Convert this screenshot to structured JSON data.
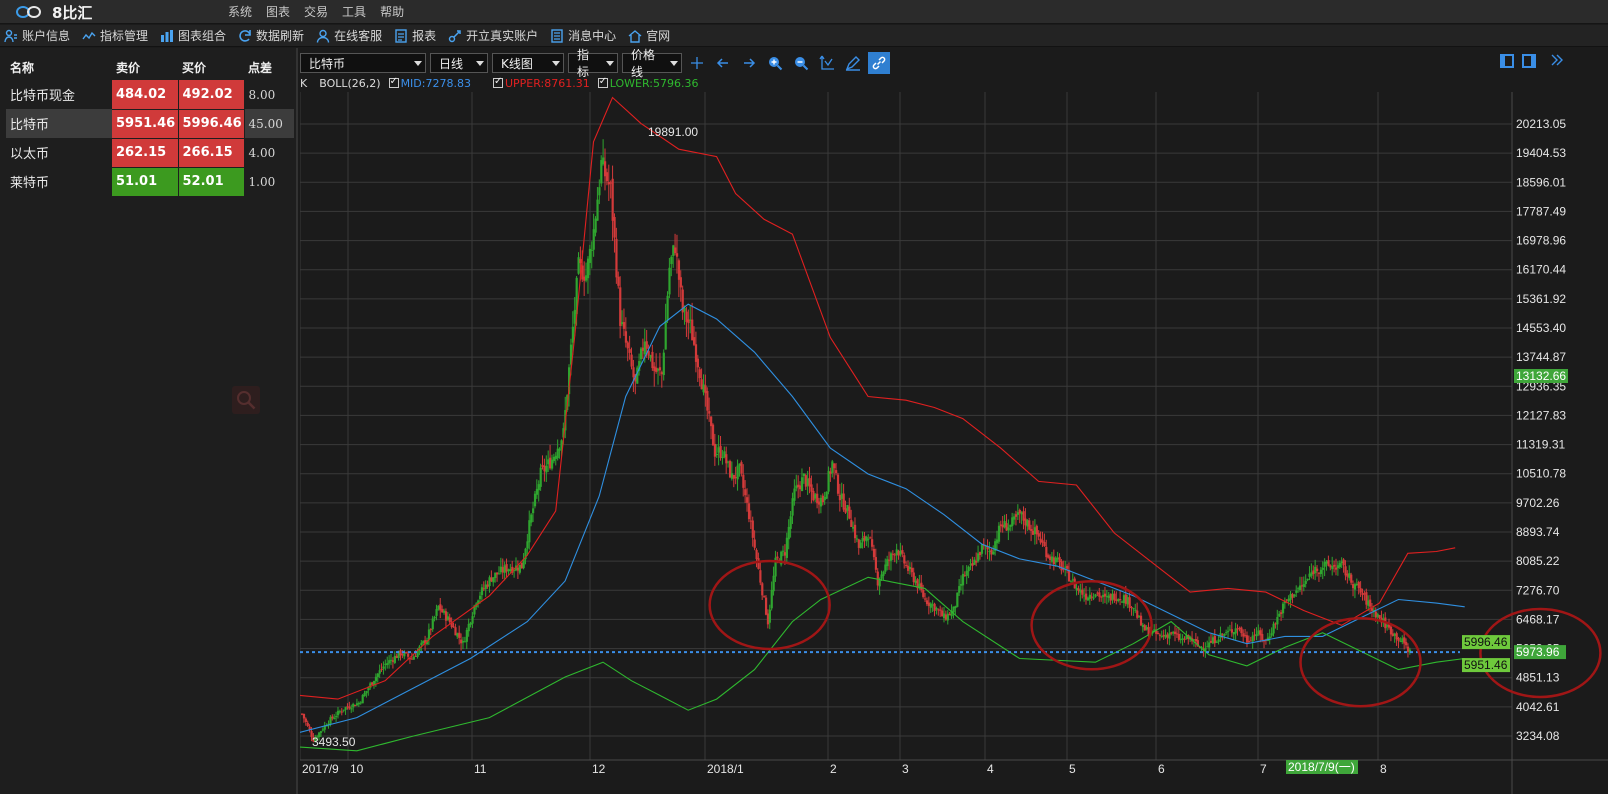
{
  "app": {
    "name": "8比汇",
    "menu": [
      "系统",
      "图表",
      "交易",
      "工具",
      "帮助"
    ]
  },
  "toolbar": [
    {
      "label": "账户信息",
      "icon": "account-icon"
    },
    {
      "label": "指标管理",
      "icon": "indicator-icon"
    },
    {
      "label": "图表组合",
      "icon": "chart-combo-icon"
    },
    {
      "label": "数据刷新",
      "icon": "refresh-icon"
    },
    {
      "label": "在线客服",
      "icon": "support-icon"
    },
    {
      "label": "报表",
      "icon": "report-icon"
    },
    {
      "label": "开立真实账户",
      "icon": "link-icon"
    },
    {
      "label": "消息中心",
      "icon": "message-icon"
    },
    {
      "label": "官网",
      "icon": "home-icon"
    }
  ],
  "quotes": {
    "headers": {
      "name": "名称",
      "bid": "卖价",
      "ask": "买价",
      "spread": "点差"
    },
    "rows": [
      {
        "name": "比特币现金",
        "bid": "484.02",
        "ask": "492.02",
        "spread": "8.00",
        "color": "red",
        "selected": false
      },
      {
        "name": "比特币",
        "bid": "5951.46",
        "ask": "5996.46",
        "spread": "45.00",
        "color": "red",
        "selected": true
      },
      {
        "name": "以太币",
        "bid": "262.15",
        "ask": "266.15",
        "spread": "4.00",
        "color": "red",
        "selected": false
      },
      {
        "name": "莱特币",
        "bid": "51.01",
        "ask": "52.01",
        "spread": "1.00",
        "color": "green",
        "selected": false
      }
    ]
  },
  "chart_toolbar": {
    "symbol": "比特币",
    "period": "日线",
    "chart_type": "K线图",
    "indicator": "指标",
    "price_line": "价格线"
  },
  "legend": {
    "prefix": "K",
    "indicator": "BOLL(26,2)",
    "mid": "MID:7278.83",
    "upper": "UPPER:8761.31",
    "lower": "LOWER:5796.36"
  },
  "colors": {
    "up": "#2fa52f",
    "down": "#d33a3a",
    "mid": "#2f8fe0",
    "upper": "#e02020",
    "lower": "#2fb82f",
    "grid": "#3a3a3a",
    "price_line": "#3b8fea"
  },
  "chart_data": {
    "type": "candlestick",
    "symbol": "比特币",
    "period": "日线",
    "indicator": "BOLL(26,2)",
    "x_axis_labels": [
      "2017/9",
      "10",
      "11",
      "12",
      "2018/1",
      "2",
      "3",
      "4",
      "5",
      "6",
      "7",
      "8"
    ],
    "y_axis_ticks": [
      "20213.05",
      "19404.53",
      "18596.01",
      "17787.49",
      "16978.96",
      "16170.44",
      "15361.92",
      "14553.40",
      "13744.87",
      "12936.35",
      "12127.83",
      "11319.31",
      "10510.78",
      "9702.26",
      "8893.74",
      "8085.22",
      "7276.70",
      "6468.17",
      "5659.65",
      "4851.13",
      "4042.61",
      "3234.08"
    ],
    "ylim": [
      3050,
      21150
    ],
    "high_label": "19891.00",
    "low_label": "3493.50",
    "crosshair_date": "2018/7/9(一)",
    "price_tags": {
      "ask": "5996.46",
      "last": "5973.96",
      "bid": "5951.46",
      "crosshair": "13132.66"
    },
    "price_line_value": 5973.96,
    "close_path": [
      [
        0,
        4300
      ],
      [
        6,
        3600
      ],
      [
        14,
        4100
      ],
      [
        22,
        4450
      ],
      [
        30,
        4600
      ],
      [
        38,
        5250
      ],
      [
        44,
        5650
      ],
      [
        52,
        5950
      ],
      [
        58,
        5800
      ],
      [
        66,
        6350
      ],
      [
        72,
        7200
      ],
      [
        78,
        6800
      ],
      [
        85,
        6200
      ],
      [
        92,
        7400
      ],
      [
        100,
        8000
      ],
      [
        108,
        8250
      ],
      [
        116,
        8300
      ],
      [
        120,
        9400
      ],
      [
        126,
        10800
      ],
      [
        132,
        11200
      ],
      [
        138,
        11900
      ],
      [
        142,
        14200
      ],
      [
        146,
        16400
      ],
      [
        150,
        16200
      ],
      [
        154,
        17400
      ],
      [
        158,
        19200
      ],
      [
        163,
        18500
      ],
      [
        168,
        15000
      ],
      [
        172,
        14100
      ],
      [
        176,
        13200
      ],
      [
        181,
        14500
      ],
      [
        186,
        13600
      ],
      [
        190,
        13500
      ],
      [
        194,
        16400
      ],
      [
        197,
        17000
      ],
      [
        201,
        15200
      ],
      [
        205,
        14800
      ],
      [
        210,
        13600
      ],
      [
        214,
        12500
      ],
      [
        218,
        11400
      ],
      [
        222,
        11400
      ],
      [
        227,
        10700
      ],
      [
        231,
        10900
      ],
      [
        236,
        9700
      ],
      [
        241,
        8200
      ],
      [
        246,
        6800
      ],
      [
        250,
        8400
      ],
      [
        255,
        8700
      ],
      [
        260,
        10300
      ],
      [
        265,
        10700
      ],
      [
        270,
        10200
      ],
      [
        275,
        10100
      ],
      [
        280,
        11100
      ],
      [
        284,
        10200
      ],
      [
        289,
        9700
      ],
      [
        294,
        8800
      ],
      [
        299,
        9200
      ],
      [
        304,
        7900
      ],
      [
        309,
        8400
      ],
      [
        314,
        8800
      ],
      [
        319,
        8300
      ],
      [
        324,
        7900
      ],
      [
        329,
        7400
      ],
      [
        334,
        7200
      ],
      [
        339,
        6900
      ],
      [
        344,
        7100
      ],
      [
        349,
        8000
      ],
      [
        354,
        8300
      ],
      [
        359,
        8800
      ],
      [
        364,
        8700
      ],
      [
        369,
        9400
      ],
      [
        374,
        9400
      ],
      [
        379,
        9700
      ],
      [
        384,
        9400
      ],
      [
        389,
        9100
      ],
      [
        394,
        8600
      ],
      [
        399,
        8400
      ],
      [
        404,
        8100
      ],
      [
        409,
        7700
      ],
      [
        414,
        7500
      ],
      [
        419,
        7600
      ],
      [
        424,
        7400
      ],
      [
        429,
        7500
      ],
      [
        434,
        7450
      ],
      [
        439,
        7200
      ],
      [
        444,
        6600
      ],
      [
        449,
        6500
      ],
      [
        454,
        6400
      ],
      [
        459,
        6500
      ],
      [
        464,
        6300
      ],
      [
        469,
        6350
      ],
      [
        474,
        6100
      ],
      [
        479,
        6200
      ],
      [
        484,
        6400
      ],
      [
        489,
        6500
      ],
      [
        494,
        6650
      ],
      [
        499,
        6300
      ],
      [
        504,
        6500
      ],
      [
        509,
        6250
      ],
      [
        514,
        6800
      ],
      [
        519,
        7300
      ],
      [
        524,
        7600
      ],
      [
        529,
        7800
      ],
      [
        534,
        8200
      ],
      [
        539,
        8300
      ],
      [
        544,
        8300
      ],
      [
        549,
        8300
      ],
      [
        554,
        7900
      ],
      [
        559,
        7600
      ],
      [
        564,
        7200
      ],
      [
        569,
        6900
      ],
      [
        574,
        6600
      ],
      [
        578,
        6400
      ],
      [
        582,
        6200
      ],
      [
        585,
        5970
      ]
    ],
    "series": [
      {
        "name": "UPPER",
        "points": [
          [
            0,
            4800
          ],
          [
            20,
            4700
          ],
          [
            45,
            5200
          ],
          [
            70,
            6400
          ],
          [
            100,
            7500
          ],
          [
            120,
            8600
          ],
          [
            135,
            9800
          ],
          [
            145,
            14500
          ],
          [
            155,
            19800
          ],
          [
            165,
            21000
          ],
          [
            180,
            20300
          ],
          [
            200,
            19600
          ],
          [
            220,
            19400
          ],
          [
            230,
            18400
          ],
          [
            245,
            17700
          ],
          [
            260,
            17300
          ],
          [
            280,
            14500
          ],
          [
            300,
            12900
          ],
          [
            320,
            12800
          ],
          [
            335,
            12600
          ],
          [
            350,
            12300
          ],
          [
            370,
            11500
          ],
          [
            390,
            10600
          ],
          [
            410,
            10500
          ],
          [
            430,
            9200
          ],
          [
            450,
            8400
          ],
          [
            470,
            7600
          ],
          [
            490,
            7700
          ],
          [
            510,
            7600
          ],
          [
            530,
            7100
          ],
          [
            550,
            6700
          ],
          [
            570,
            7300
          ],
          [
            585,
            8650
          ],
          [
            600,
            8700
          ],
          [
            610,
            8800
          ]
        ]
      },
      {
        "name": "MID",
        "points": [
          [
            0,
            3800
          ],
          [
            30,
            4200
          ],
          [
            60,
            5000
          ],
          [
            90,
            5800
          ],
          [
            120,
            6800
          ],
          [
            140,
            7900
          ],
          [
            158,
            10200
          ],
          [
            172,
            12900
          ],
          [
            190,
            14800
          ],
          [
            205,
            15400
          ],
          [
            220,
            15000
          ],
          [
            240,
            14100
          ],
          [
            260,
            12900
          ],
          [
            280,
            11500
          ],
          [
            300,
            10800
          ],
          [
            320,
            10400
          ],
          [
            340,
            9700
          ],
          [
            360,
            8900
          ],
          [
            380,
            8500
          ],
          [
            400,
            8300
          ],
          [
            420,
            7900
          ],
          [
            440,
            7500
          ],
          [
            460,
            7000
          ],
          [
            480,
            6500
          ],
          [
            500,
            6200
          ],
          [
            520,
            6400
          ],
          [
            540,
            6400
          ],
          [
            560,
            6900
          ],
          [
            580,
            7400
          ],
          [
            600,
            7300
          ],
          [
            615,
            7200
          ]
        ]
      },
      {
        "name": "LOWER",
        "points": [
          [
            0,
            3400
          ],
          [
            30,
            3300
          ],
          [
            60,
            3700
          ],
          [
            100,
            4200
          ],
          [
            140,
            5300
          ],
          [
            160,
            5700
          ],
          [
            175,
            5200
          ],
          [
            190,
            4800
          ],
          [
            205,
            4400
          ],
          [
            220,
            4700
          ],
          [
            240,
            5500
          ],
          [
            260,
            6800
          ],
          [
            275,
            7400
          ],
          [
            300,
            8000
          ],
          [
            330,
            7700
          ],
          [
            350,
            6800
          ],
          [
            380,
            5800
          ],
          [
            420,
            5700
          ],
          [
            440,
            6200
          ],
          [
            460,
            6800
          ],
          [
            480,
            5900
          ],
          [
            500,
            5600
          ],
          [
            520,
            6100
          ],
          [
            540,
            6500
          ],
          [
            560,
            6000
          ],
          [
            580,
            5500
          ],
          [
            600,
            5700
          ],
          [
            615,
            5800
          ]
        ]
      }
    ],
    "annotations": [
      {
        "type": "ellipse",
        "x": 248,
        "y": 7250
      },
      {
        "type": "ellipse",
        "x": 418,
        "y": 6700
      },
      {
        "type": "ellipse",
        "x": 560,
        "y": 5700
      },
      {
        "type": "ellipse",
        "x": 655,
        "y": 5950
      }
    ]
  }
}
